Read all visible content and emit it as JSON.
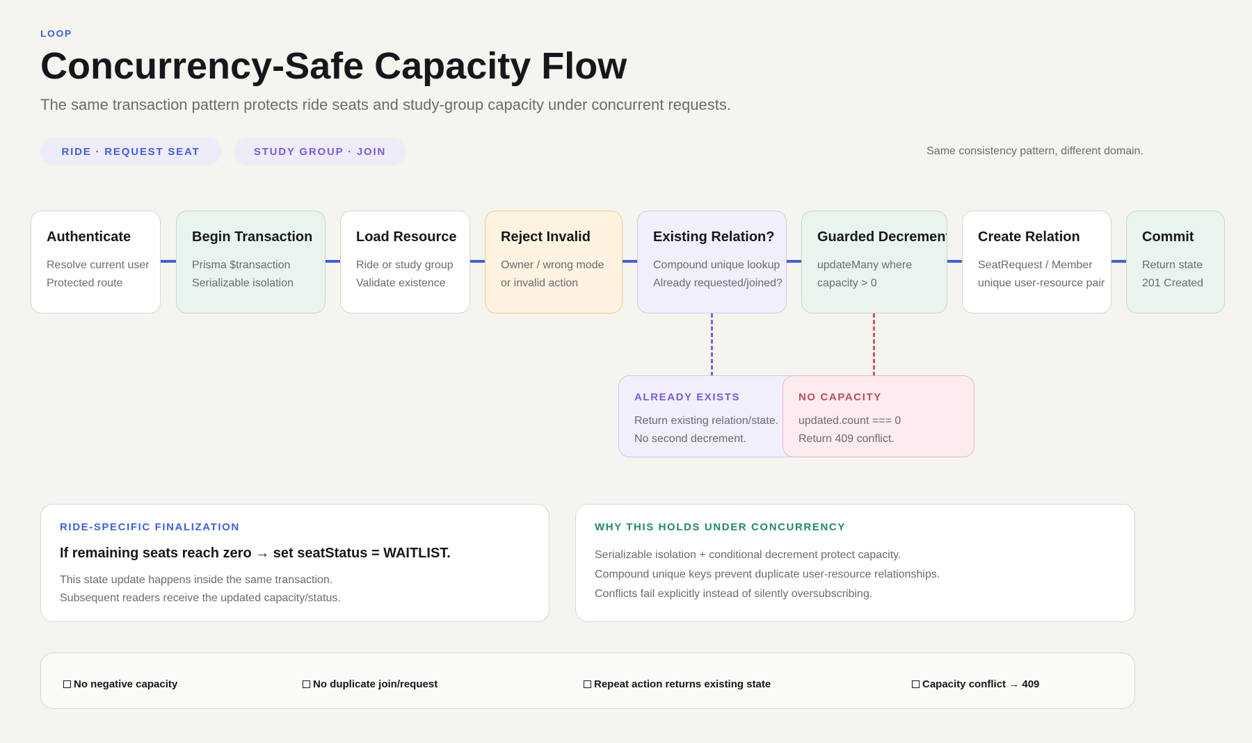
{
  "header": {
    "eyebrow": "LOOP",
    "title": "Concurrency-Safe Capacity Flow",
    "subtitle": "The same transaction pattern protects ride seats and study-group capacity under concurrent requests."
  },
  "pills": {
    "ride": "RIDE · REQUEST SEAT",
    "study": "STUDY GROUP · JOIN"
  },
  "pattern_note": "Same consistency pattern, different domain.",
  "steps": [
    {
      "title": "Authenticate",
      "lines": [
        "Resolve current user",
        "Protected route"
      ]
    },
    {
      "title": "Begin Transaction",
      "lines": [
        "Prisma $transaction",
        "Serializable isolation"
      ]
    },
    {
      "title": "Load Resource",
      "lines": [
        "Ride or study group",
        "Validate existence"
      ]
    },
    {
      "title": "Reject Invalid",
      "lines": [
        "Owner / wrong mode",
        "or invalid action"
      ]
    },
    {
      "title": "Existing Relation?",
      "lines": [
        "Compound unique lookup",
        "Already requested/joined?"
      ]
    },
    {
      "title": "Guarded Decrement",
      "lines": [
        "updateMany where",
        "capacity > 0"
      ]
    },
    {
      "title": "Create Relation",
      "lines": [
        "SeatRequest / Member",
        "unique user-resource pair"
      ]
    },
    {
      "title": "Commit",
      "lines": [
        "Return state",
        "201 Created"
      ]
    }
  ],
  "branches": {
    "exists": {
      "tag": "ALREADY EXISTS",
      "lines": [
        "Return existing relation/state.",
        "No second decrement."
      ]
    },
    "nocap": {
      "tag": "NO CAPACITY",
      "lines": [
        "updated.count === 0",
        "Return 409 conflict."
      ]
    }
  },
  "ride_panel": {
    "tag": "RIDE-SPECIFIC FINALIZATION",
    "rule": "If remaining seats reach zero → set seatStatus = WAITLIST.",
    "lines": [
      "This state update happens inside the same transaction.",
      "Subsequent readers receive the updated capacity/status."
    ]
  },
  "why_panel": {
    "tag": "WHY THIS HOLDS UNDER CONCURRENCY",
    "lines": [
      "Serializable isolation + conditional decrement protect capacity.",
      "Compound unique keys prevent duplicate user-resource relationships.",
      "Conflicts fail explicitly instead of silently oversubscribing."
    ]
  },
  "guarantees": [
    "No negative capacity",
    "No duplicate join/request",
    "Repeat action returns existing state",
    "Capacity conflict → 409"
  ],
  "colors": {
    "accent_blue": "#3f5fe0",
    "accent_violet": "#7a5be0",
    "accent_green": "#1f8a63",
    "accent_red": "#c24a55",
    "background": "#f6f4ee"
  }
}
